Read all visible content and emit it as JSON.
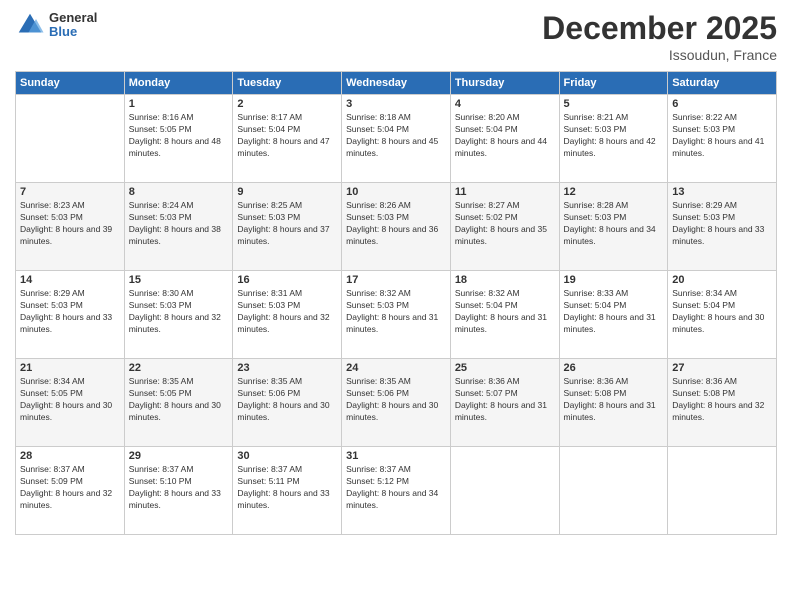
{
  "header": {
    "logo_line1": "General",
    "logo_line2": "Blue",
    "month_title": "December 2025",
    "location": "Issoudun, France"
  },
  "weekdays": [
    "Sunday",
    "Monday",
    "Tuesday",
    "Wednesday",
    "Thursday",
    "Friday",
    "Saturday"
  ],
  "weeks": [
    [
      {
        "day": "",
        "sunrise": "",
        "sunset": "",
        "daylight": ""
      },
      {
        "day": "1",
        "sunrise": "Sunrise: 8:16 AM",
        "sunset": "Sunset: 5:05 PM",
        "daylight": "Daylight: 8 hours and 48 minutes."
      },
      {
        "day": "2",
        "sunrise": "Sunrise: 8:17 AM",
        "sunset": "Sunset: 5:04 PM",
        "daylight": "Daylight: 8 hours and 47 minutes."
      },
      {
        "day": "3",
        "sunrise": "Sunrise: 8:18 AM",
        "sunset": "Sunset: 5:04 PM",
        "daylight": "Daylight: 8 hours and 45 minutes."
      },
      {
        "day": "4",
        "sunrise": "Sunrise: 8:20 AM",
        "sunset": "Sunset: 5:04 PM",
        "daylight": "Daylight: 8 hours and 44 minutes."
      },
      {
        "day": "5",
        "sunrise": "Sunrise: 8:21 AM",
        "sunset": "Sunset: 5:03 PM",
        "daylight": "Daylight: 8 hours and 42 minutes."
      },
      {
        "day": "6",
        "sunrise": "Sunrise: 8:22 AM",
        "sunset": "Sunset: 5:03 PM",
        "daylight": "Daylight: 8 hours and 41 minutes."
      }
    ],
    [
      {
        "day": "7",
        "sunrise": "Sunrise: 8:23 AM",
        "sunset": "Sunset: 5:03 PM",
        "daylight": "Daylight: 8 hours and 39 minutes."
      },
      {
        "day": "8",
        "sunrise": "Sunrise: 8:24 AM",
        "sunset": "Sunset: 5:03 PM",
        "daylight": "Daylight: 8 hours and 38 minutes."
      },
      {
        "day": "9",
        "sunrise": "Sunrise: 8:25 AM",
        "sunset": "Sunset: 5:03 PM",
        "daylight": "Daylight: 8 hours and 37 minutes."
      },
      {
        "day": "10",
        "sunrise": "Sunrise: 8:26 AM",
        "sunset": "Sunset: 5:03 PM",
        "daylight": "Daylight: 8 hours and 36 minutes."
      },
      {
        "day": "11",
        "sunrise": "Sunrise: 8:27 AM",
        "sunset": "Sunset: 5:02 PM",
        "daylight": "Daylight: 8 hours and 35 minutes."
      },
      {
        "day": "12",
        "sunrise": "Sunrise: 8:28 AM",
        "sunset": "Sunset: 5:03 PM",
        "daylight": "Daylight: 8 hours and 34 minutes."
      },
      {
        "day": "13",
        "sunrise": "Sunrise: 8:29 AM",
        "sunset": "Sunset: 5:03 PM",
        "daylight": "Daylight: 8 hours and 33 minutes."
      }
    ],
    [
      {
        "day": "14",
        "sunrise": "Sunrise: 8:29 AM",
        "sunset": "Sunset: 5:03 PM",
        "daylight": "Daylight: 8 hours and 33 minutes."
      },
      {
        "day": "15",
        "sunrise": "Sunrise: 8:30 AM",
        "sunset": "Sunset: 5:03 PM",
        "daylight": "Daylight: 8 hours and 32 minutes."
      },
      {
        "day": "16",
        "sunrise": "Sunrise: 8:31 AM",
        "sunset": "Sunset: 5:03 PM",
        "daylight": "Daylight: 8 hours and 32 minutes."
      },
      {
        "day": "17",
        "sunrise": "Sunrise: 8:32 AM",
        "sunset": "Sunset: 5:03 PM",
        "daylight": "Daylight: 8 hours and 31 minutes."
      },
      {
        "day": "18",
        "sunrise": "Sunrise: 8:32 AM",
        "sunset": "Sunset: 5:04 PM",
        "daylight": "Daylight: 8 hours and 31 minutes."
      },
      {
        "day": "19",
        "sunrise": "Sunrise: 8:33 AM",
        "sunset": "Sunset: 5:04 PM",
        "daylight": "Daylight: 8 hours and 31 minutes."
      },
      {
        "day": "20",
        "sunrise": "Sunrise: 8:34 AM",
        "sunset": "Sunset: 5:04 PM",
        "daylight": "Daylight: 8 hours and 30 minutes."
      }
    ],
    [
      {
        "day": "21",
        "sunrise": "Sunrise: 8:34 AM",
        "sunset": "Sunset: 5:05 PM",
        "daylight": "Daylight: 8 hours and 30 minutes."
      },
      {
        "day": "22",
        "sunrise": "Sunrise: 8:35 AM",
        "sunset": "Sunset: 5:05 PM",
        "daylight": "Daylight: 8 hours and 30 minutes."
      },
      {
        "day": "23",
        "sunrise": "Sunrise: 8:35 AM",
        "sunset": "Sunset: 5:06 PM",
        "daylight": "Daylight: 8 hours and 30 minutes."
      },
      {
        "day": "24",
        "sunrise": "Sunrise: 8:35 AM",
        "sunset": "Sunset: 5:06 PM",
        "daylight": "Daylight: 8 hours and 30 minutes."
      },
      {
        "day": "25",
        "sunrise": "Sunrise: 8:36 AM",
        "sunset": "Sunset: 5:07 PM",
        "daylight": "Daylight: 8 hours and 31 minutes."
      },
      {
        "day": "26",
        "sunrise": "Sunrise: 8:36 AM",
        "sunset": "Sunset: 5:08 PM",
        "daylight": "Daylight: 8 hours and 31 minutes."
      },
      {
        "day": "27",
        "sunrise": "Sunrise: 8:36 AM",
        "sunset": "Sunset: 5:08 PM",
        "daylight": "Daylight: 8 hours and 32 minutes."
      }
    ],
    [
      {
        "day": "28",
        "sunrise": "Sunrise: 8:37 AM",
        "sunset": "Sunset: 5:09 PM",
        "daylight": "Daylight: 8 hours and 32 minutes."
      },
      {
        "day": "29",
        "sunrise": "Sunrise: 8:37 AM",
        "sunset": "Sunset: 5:10 PM",
        "daylight": "Daylight: 8 hours and 33 minutes."
      },
      {
        "day": "30",
        "sunrise": "Sunrise: 8:37 AM",
        "sunset": "Sunset: 5:11 PM",
        "daylight": "Daylight: 8 hours and 33 minutes."
      },
      {
        "day": "31",
        "sunrise": "Sunrise: 8:37 AM",
        "sunset": "Sunset: 5:12 PM",
        "daylight": "Daylight: 8 hours and 34 minutes."
      },
      {
        "day": "",
        "sunrise": "",
        "sunset": "",
        "daylight": ""
      },
      {
        "day": "",
        "sunrise": "",
        "sunset": "",
        "daylight": ""
      },
      {
        "day": "",
        "sunrise": "",
        "sunset": "",
        "daylight": ""
      }
    ]
  ]
}
